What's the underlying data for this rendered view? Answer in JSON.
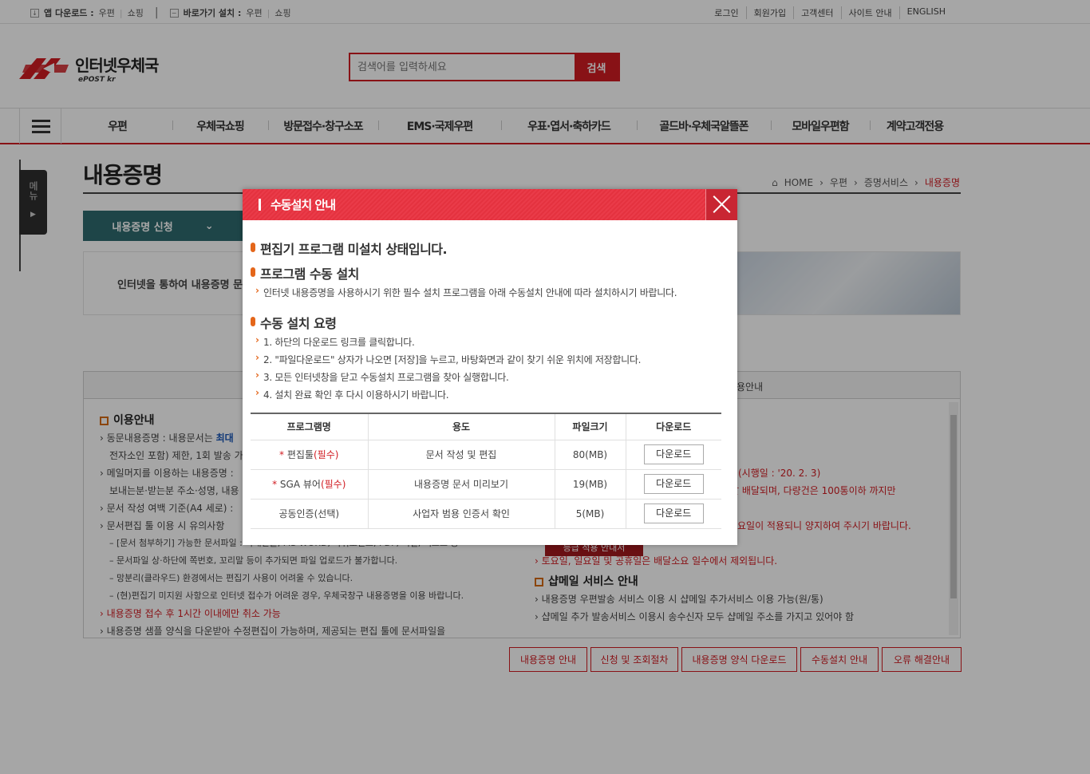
{
  "topbar": {
    "app_download_label": "앱 다운로드 :",
    "app_links": [
      "우편",
      "쇼핑"
    ],
    "shortcut_label": "바로가기 설치 :",
    "shortcut_links": [
      "우편",
      "쇼핑"
    ],
    "util_links": [
      "로그인",
      "회원가입",
      "고객센터",
      "사이트 안내",
      "ENGLISH"
    ]
  },
  "header": {
    "logo_kor": "인터넷우체국",
    "logo_eng": "ePOST kr",
    "search_placeholder": "검색어를 입력하세요",
    "search_button": "검색"
  },
  "gnb": {
    "items": [
      "우편",
      "우체국쇼핑",
      "방문접수·창구소포",
      "EMS·국제우편",
      "우표·엽서·축하카드",
      "골드바·우체국알뜰폰",
      "모바일우편함",
      "계약고객전용"
    ]
  },
  "page": {
    "side_menu": "메뉴",
    "title": "내용증명",
    "breadcrumb": [
      "HOME",
      "우편",
      "증명서비스",
      "내용증명"
    ],
    "subnav": "내용증명 신청",
    "intro_text": "인터넷을 통하여 내용증명 문",
    "tab_right_label": "용안내",
    "left_col": {
      "heading": "이용안내",
      "lines": [
        "동문내용증명 : 내용문서는",
        "전자소인 포함) 제한, 1회 발송 가",
        "메일머지를 이용하는 내용증명 :",
        "보내는분·받는분 주소·성명, 내용",
        "문서 작성 여백 기준(A4 세로) :",
        "문서편집 툴 이용 시 유의사항",
        "[문서 첨부하기] 가능한 문서파일 : 아래한글, MS-WORD, 파워포인트, PDF, 엑셀, 텍스트 등",
        "문서파일 상·하단에 쪽번호, 꼬리말 등이 추가되면 파일 업로드가 불가합니다.",
        "망분리(클라우드) 환경에서는 편집기 사용이 어려울 수 있습니다.",
        "(현)편집기 미지원 사항으로 인터넷 접수가 어려운 경우, 우체국창구 내용증명을 이용 바랍니다.",
        "내용증명 접수 후 1시간 이내에만 취소 가능",
        "내용증명 샘플 양식을 다운받아 수정편집이 가능하며, 제공되는 편집 툴에 문서파일을"
      ],
      "highlight": "최대"
    },
    "right_col": {
      "line1": "(시행일 : '20. 2. 3)",
      "line2": "날 배달되며, 다량건은 100통이하 까지만",
      "line3": "요일이 적용되니 양지하여 주시기 바랍니다.",
      "notice_btn": "등급 적용 안내서",
      "line4": "토요일, 일요일 및 공휴일은 배달소요 일수에서 제외됩니다.",
      "heading": "샵메일 서비스 안내",
      "line5": "내용증명 우편발송 서비스 이용 시 샵메일 추가서비스 이용 가능(원/통)",
      "line6": "샵메일 추가 발송서비스 이용시 송수신자 모두 샵메일 주소를 가지고 있어야 함"
    },
    "buttons": [
      "내용증명 안내",
      "신청 및 조회절차",
      "내용증명 양식 다운로드",
      "수동설치 안내",
      "오류 해결안내"
    ]
  },
  "modal": {
    "title": "수동설치 안내",
    "heading1": "편집기 프로그램 미설치 상태입니다.",
    "heading2": "프로그램 수동 설치",
    "desc": "인터넷 내용증명을 사용하시기 위한 필수 설치 프로그램을 아래 수동설치 안내에 따라 설치하시기 바랍니다.",
    "heading3": "수동 설치 요령",
    "steps": [
      "1. 하단의 다운로드 링크를 클릭합니다.",
      "2. \"파일다운로드\" 상자가 나오면 [저장]을 누르고, 바탕화면과 같이 찾기 쉬운 위치에 저장합니다.",
      "3. 모든 인터넷창을 닫고 수동설치 프로그램을 찾아 실행합니다.",
      "4. 설치 완료 확인 후 다시 이용하시기 바랍니다."
    ],
    "table": {
      "headers": [
        "프로그램명",
        "용도",
        "파일크기",
        "다운로드"
      ],
      "rows": [
        {
          "star": "*",
          "name": "편집툴",
          "req": "(필수)",
          "use": "문서 작성 및 편집",
          "size": "80(MB)",
          "btn": "다운로드"
        },
        {
          "star": "*",
          "name": "SGA 뷰어",
          "req": "(필수)",
          "use": "내용증명 문서 미리보기",
          "size": "19(MB)",
          "btn": "다운로드"
        },
        {
          "star": "",
          "name": "공동인증(선택)",
          "req": "",
          "use": "사업자 범용 인증서 확인",
          "size": "5(MB)",
          "btn": "다운로드"
        }
      ]
    }
  }
}
